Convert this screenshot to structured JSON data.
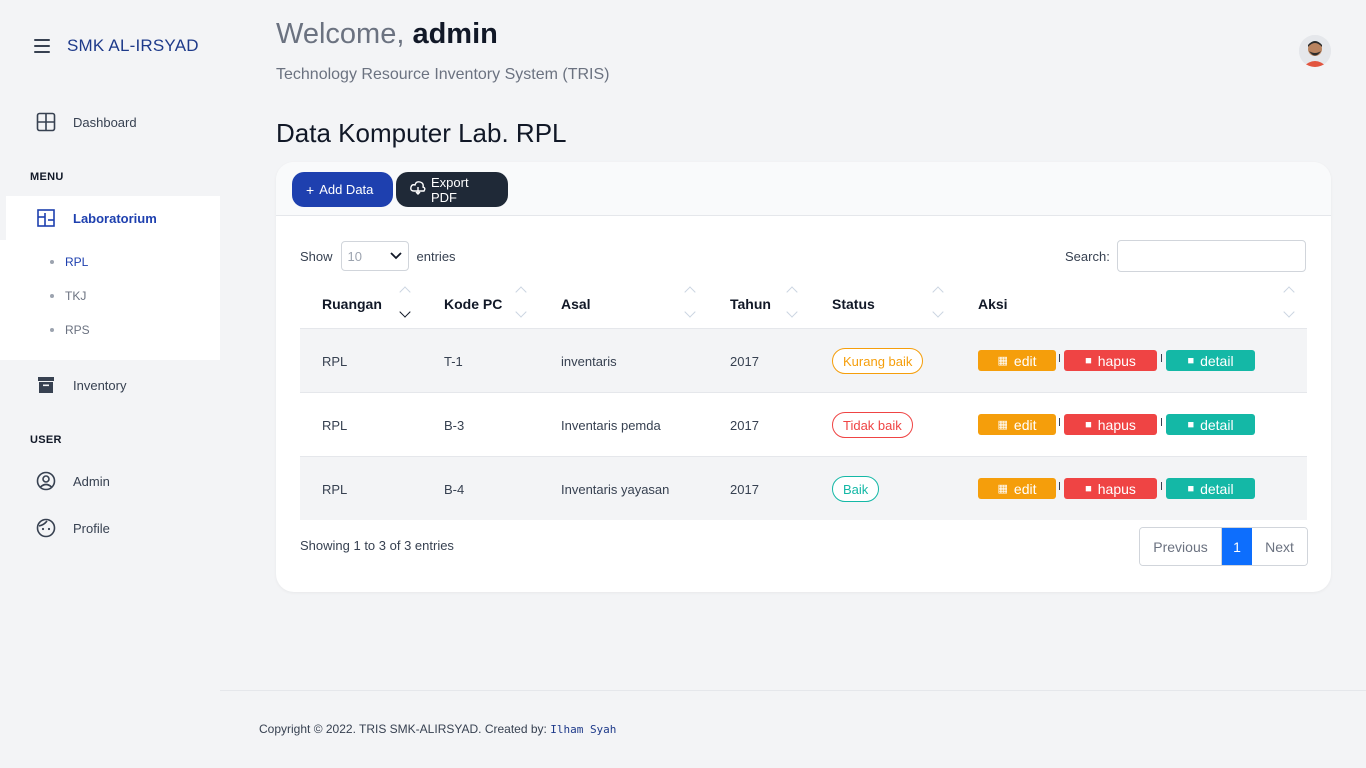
{
  "sidebar": {
    "brand": "SMK AL-IRSYAD",
    "dashboard": "Dashboard",
    "menu_label": "MENU",
    "laboratorium": "Laboratorium",
    "labs": [
      "RPL",
      "TKJ",
      "RPS"
    ],
    "inventory": "Inventory",
    "user_label": "USER",
    "admin": "Admin",
    "profile": "Profile"
  },
  "header": {
    "welcome_prefix": "Welcome,",
    "username": "admin",
    "subtitle": "Technology Resource Inventory System (TRIS)"
  },
  "page_title": "Data Komputer Lab. RPL",
  "toolbar": {
    "add_label": "Add Data",
    "export_label": "Export PDF"
  },
  "table_controls": {
    "show_label": "Show",
    "show_value": "10",
    "entries_label": "entries",
    "search_label": "Search:"
  },
  "table": {
    "headers": [
      "Ruangan",
      "Kode PC",
      "Asal",
      "Tahun",
      "Status",
      "Aksi"
    ],
    "rows": [
      {
        "ruangan": "RPL",
        "kode": "T-1",
        "asal": "inventaris",
        "tahun": "2017",
        "status": "Kurang baik"
      },
      {
        "ruangan": "RPL",
        "kode": "B-3",
        "asal": "Inventaris pemda",
        "tahun": "2017",
        "status": "Tidak baik"
      },
      {
        "ruangan": "RPL",
        "kode": "B-4",
        "asal": "Inventaris yayasan",
        "tahun": "2017",
        "status": "Baik"
      }
    ],
    "actions": {
      "edit": "edit",
      "hapus": "hapus",
      "detail": "detail"
    }
  },
  "pagination": {
    "info": "Showing 1 to 3 of 3 entries",
    "previous": "Previous",
    "current": "1",
    "next": "Next"
  },
  "footer": {
    "text": "Copyright © 2022. TRIS SMK-ALIRSYAD. Created by:",
    "author": "Ilham Syah"
  },
  "colors": {
    "primary": "#1e40af",
    "warning": "#f59e0b",
    "danger": "#ef4444",
    "success": "#14b8a6",
    "page_active": "#0d6efd"
  }
}
